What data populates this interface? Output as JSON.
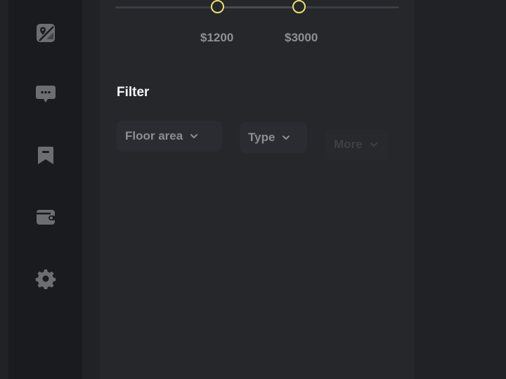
{
  "sidebar": {
    "icons": [
      {
        "name": "map-icon"
      },
      {
        "name": "chat-icon"
      },
      {
        "name": "bookmark-icon"
      },
      {
        "name": "wallet-icon"
      },
      {
        "name": "gear-icon"
      }
    ]
  },
  "price_range": {
    "min_label": "$1200",
    "max_label": "$3000"
  },
  "filter": {
    "title": "Filter",
    "chips": [
      {
        "label": "Floor area"
      },
      {
        "label": "Type"
      },
      {
        "label": "More"
      }
    ]
  },
  "colors": {
    "accent": "#e7e36b",
    "panel": "#25272b",
    "sidebar": "#1a1b1e",
    "background": "#212226",
    "icon": "#6c6e72"
  }
}
